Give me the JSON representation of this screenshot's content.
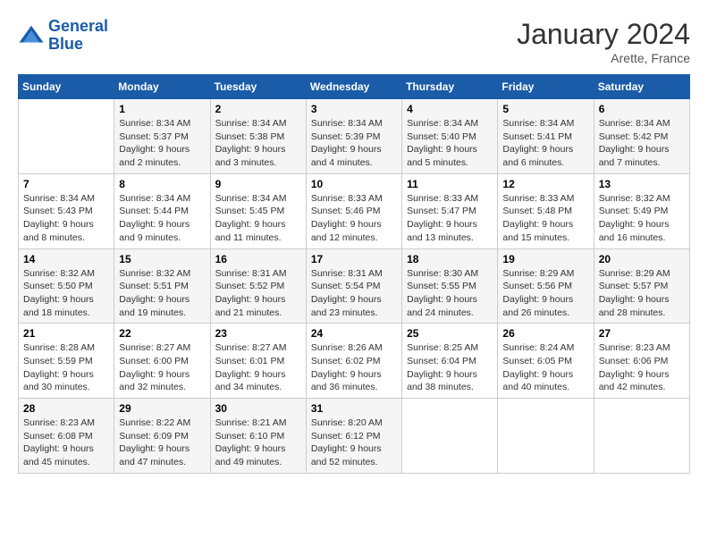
{
  "logo": {
    "line1": "General",
    "line2": "Blue"
  },
  "title": "January 2024",
  "location": "Arette, France",
  "days_header": [
    "Sunday",
    "Monday",
    "Tuesday",
    "Wednesday",
    "Thursday",
    "Friday",
    "Saturday"
  ],
  "weeks": [
    [
      {
        "num": "",
        "sunrise": "",
        "sunset": "",
        "daylight": ""
      },
      {
        "num": "1",
        "sunrise": "Sunrise: 8:34 AM",
        "sunset": "Sunset: 5:37 PM",
        "daylight": "Daylight: 9 hours and 2 minutes."
      },
      {
        "num": "2",
        "sunrise": "Sunrise: 8:34 AM",
        "sunset": "Sunset: 5:38 PM",
        "daylight": "Daylight: 9 hours and 3 minutes."
      },
      {
        "num": "3",
        "sunrise": "Sunrise: 8:34 AM",
        "sunset": "Sunset: 5:39 PM",
        "daylight": "Daylight: 9 hours and 4 minutes."
      },
      {
        "num": "4",
        "sunrise": "Sunrise: 8:34 AM",
        "sunset": "Sunset: 5:40 PM",
        "daylight": "Daylight: 9 hours and 5 minutes."
      },
      {
        "num": "5",
        "sunrise": "Sunrise: 8:34 AM",
        "sunset": "Sunset: 5:41 PM",
        "daylight": "Daylight: 9 hours and 6 minutes."
      },
      {
        "num": "6",
        "sunrise": "Sunrise: 8:34 AM",
        "sunset": "Sunset: 5:42 PM",
        "daylight": "Daylight: 9 hours and 7 minutes."
      }
    ],
    [
      {
        "num": "7",
        "sunrise": "Sunrise: 8:34 AM",
        "sunset": "Sunset: 5:43 PM",
        "daylight": "Daylight: 9 hours and 8 minutes."
      },
      {
        "num": "8",
        "sunrise": "Sunrise: 8:34 AM",
        "sunset": "Sunset: 5:44 PM",
        "daylight": "Daylight: 9 hours and 9 minutes."
      },
      {
        "num": "9",
        "sunrise": "Sunrise: 8:34 AM",
        "sunset": "Sunset: 5:45 PM",
        "daylight": "Daylight: 9 hours and 11 minutes."
      },
      {
        "num": "10",
        "sunrise": "Sunrise: 8:33 AM",
        "sunset": "Sunset: 5:46 PM",
        "daylight": "Daylight: 9 hours and 12 minutes."
      },
      {
        "num": "11",
        "sunrise": "Sunrise: 8:33 AM",
        "sunset": "Sunset: 5:47 PM",
        "daylight": "Daylight: 9 hours and 13 minutes."
      },
      {
        "num": "12",
        "sunrise": "Sunrise: 8:33 AM",
        "sunset": "Sunset: 5:48 PM",
        "daylight": "Daylight: 9 hours and 15 minutes."
      },
      {
        "num": "13",
        "sunrise": "Sunrise: 8:32 AM",
        "sunset": "Sunset: 5:49 PM",
        "daylight": "Daylight: 9 hours and 16 minutes."
      }
    ],
    [
      {
        "num": "14",
        "sunrise": "Sunrise: 8:32 AM",
        "sunset": "Sunset: 5:50 PM",
        "daylight": "Daylight: 9 hours and 18 minutes."
      },
      {
        "num": "15",
        "sunrise": "Sunrise: 8:32 AM",
        "sunset": "Sunset: 5:51 PM",
        "daylight": "Daylight: 9 hours and 19 minutes."
      },
      {
        "num": "16",
        "sunrise": "Sunrise: 8:31 AM",
        "sunset": "Sunset: 5:52 PM",
        "daylight": "Daylight: 9 hours and 21 minutes."
      },
      {
        "num": "17",
        "sunrise": "Sunrise: 8:31 AM",
        "sunset": "Sunset: 5:54 PM",
        "daylight": "Daylight: 9 hours and 23 minutes."
      },
      {
        "num": "18",
        "sunrise": "Sunrise: 8:30 AM",
        "sunset": "Sunset: 5:55 PM",
        "daylight": "Daylight: 9 hours and 24 minutes."
      },
      {
        "num": "19",
        "sunrise": "Sunrise: 8:29 AM",
        "sunset": "Sunset: 5:56 PM",
        "daylight": "Daylight: 9 hours and 26 minutes."
      },
      {
        "num": "20",
        "sunrise": "Sunrise: 8:29 AM",
        "sunset": "Sunset: 5:57 PM",
        "daylight": "Daylight: 9 hours and 28 minutes."
      }
    ],
    [
      {
        "num": "21",
        "sunrise": "Sunrise: 8:28 AM",
        "sunset": "Sunset: 5:59 PM",
        "daylight": "Daylight: 9 hours and 30 minutes."
      },
      {
        "num": "22",
        "sunrise": "Sunrise: 8:27 AM",
        "sunset": "Sunset: 6:00 PM",
        "daylight": "Daylight: 9 hours and 32 minutes."
      },
      {
        "num": "23",
        "sunrise": "Sunrise: 8:27 AM",
        "sunset": "Sunset: 6:01 PM",
        "daylight": "Daylight: 9 hours and 34 minutes."
      },
      {
        "num": "24",
        "sunrise": "Sunrise: 8:26 AM",
        "sunset": "Sunset: 6:02 PM",
        "daylight": "Daylight: 9 hours and 36 minutes."
      },
      {
        "num": "25",
        "sunrise": "Sunrise: 8:25 AM",
        "sunset": "Sunset: 6:04 PM",
        "daylight": "Daylight: 9 hours and 38 minutes."
      },
      {
        "num": "26",
        "sunrise": "Sunrise: 8:24 AM",
        "sunset": "Sunset: 6:05 PM",
        "daylight": "Daylight: 9 hours and 40 minutes."
      },
      {
        "num": "27",
        "sunrise": "Sunrise: 8:23 AM",
        "sunset": "Sunset: 6:06 PM",
        "daylight": "Daylight: 9 hours and 42 minutes."
      }
    ],
    [
      {
        "num": "28",
        "sunrise": "Sunrise: 8:23 AM",
        "sunset": "Sunset: 6:08 PM",
        "daylight": "Daylight: 9 hours and 45 minutes."
      },
      {
        "num": "29",
        "sunrise": "Sunrise: 8:22 AM",
        "sunset": "Sunset: 6:09 PM",
        "daylight": "Daylight: 9 hours and 47 minutes."
      },
      {
        "num": "30",
        "sunrise": "Sunrise: 8:21 AM",
        "sunset": "Sunset: 6:10 PM",
        "daylight": "Daylight: 9 hours and 49 minutes."
      },
      {
        "num": "31",
        "sunrise": "Sunrise: 8:20 AM",
        "sunset": "Sunset: 6:12 PM",
        "daylight": "Daylight: 9 hours and 52 minutes."
      },
      {
        "num": "",
        "sunrise": "",
        "sunset": "",
        "daylight": ""
      },
      {
        "num": "",
        "sunrise": "",
        "sunset": "",
        "daylight": ""
      },
      {
        "num": "",
        "sunrise": "",
        "sunset": "",
        "daylight": ""
      }
    ]
  ]
}
